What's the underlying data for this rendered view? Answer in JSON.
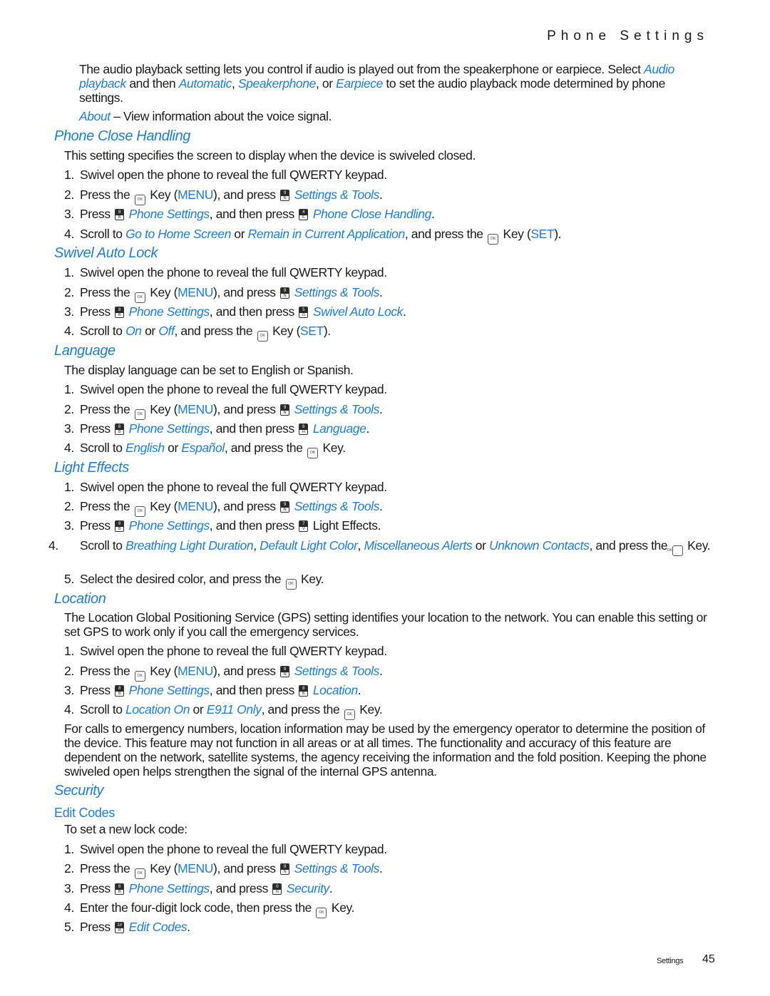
{
  "header": {
    "running_title": "Phone Settings"
  },
  "icons": {
    "ok_key": {
      "name": "ok-key-icon",
      "label": "OK"
    },
    "key_9N": {
      "top": "9",
      "bottom": "N"
    },
    "key_8B": {
      "top": "8",
      "bottom": "B"
    },
    "key_4F": {
      "top": "4",
      "bottom": "F"
    },
    "key_5G": {
      "top": "5",
      "bottom": "G"
    },
    "key_6H": {
      "top": "6",
      "bottom": "H"
    },
    "key_7V": {
      "top": "7",
      "bottom": "V"
    },
    "key_8B2": {
      "top": "8",
      "bottom": "B"
    },
    "key_0N": {
      "top": "0",
      "bottom": "N"
    },
    "key_1R": {
      "top": "1#",
      "bottom": "R"
    }
  },
  "colors": {
    "accent": "#1a7ee0",
    "text": "#1a1a1a"
  },
  "intro": {
    "p1_a": "The audio playback setting lets you control if audio is played out from the speakerphone or earpiece. Select ",
    "p1_link1": "Audio playback",
    "p1_b": " and then ",
    "p1_link2": "Automatic",
    "p1_c": ", ",
    "p1_link3": "Speakerphone",
    "p1_d": ", or ",
    "p1_link4": "Earpiece",
    "p1_e": " to set the audio playback mode determined by phone settings.",
    "about_link": "About",
    "about_text": " – View information about the voice signal."
  },
  "common": {
    "step1": "Swivel open the phone to reveal the full QWERTY keypad.",
    "press_the": "Press the ",
    "key_menu_a": " Key (",
    "menu": "MENU",
    "key_menu_b": "), and press ",
    "settings_tools": "Settings & Tools",
    "period": ".",
    "press": "Press ",
    "phone_settings": "Phone Settings",
    "and_then_press": ", and then press ",
    "and_press": ", and press ",
    "scroll_to": "Scroll to ",
    "or": " or ",
    "and_press_the": ", and press the ",
    "key_set_a": " Key (",
    "set": "SET",
    "key_set_b": ").",
    "key_end": " Key."
  },
  "sections": {
    "phone_close": {
      "title": "Phone Close Handling",
      "desc": "This setting specifies the screen to display when the device is swiveled closed.",
      "target": "Phone Close Handling",
      "opt1": "Go to Home Screen",
      "opt2": "Remain in Current Application"
    },
    "swivel_lock": {
      "title": "Swivel Auto Lock",
      "target": "Swivel Auto Lock",
      "opt1": "On",
      "opt2": "Off"
    },
    "language": {
      "title": "Language",
      "desc": "The display language can be set to English or Spanish.",
      "target": "Language",
      "opt1": "English",
      "opt2": "Español"
    },
    "light_effects": {
      "title": "Light Effects",
      "target_plain": " Light Effects.",
      "opt1": "Breathing Light Duration",
      "opt2": "Default Light Color",
      "opt3": "Miscellaneous Alerts",
      "opt4": "Unknown Contacts",
      "step4_sep": ", ",
      "step4_end": ", and press the ",
      "step4_key": "Key.",
      "step5": "Select the desired color, and press the "
    },
    "location": {
      "title": "Location",
      "desc": "The Location Global Positioning Service (GPS) setting identifies your location to the network. You can enable this setting or set GPS to work only if you call the emergency services.",
      "target": "Location",
      "opt1": "Location On",
      "opt2": "E911 Only",
      "note": "For calls to emergency numbers, location information may be used by the emergency operator to determine the position of the device. This feature may not function in all areas or at all times. The functionality and accuracy of this feature are dependent on the network, satellite systems, the agency receiving the information and the fold position. Keeping the phone swiveled open helps strengthen the signal of the internal GPS antenna."
    },
    "security": {
      "title": "Security",
      "subtitle": "Edit Codes",
      "desc": "To set a new lock code:",
      "target": "Security",
      "step4": "Enter the four-digit lock code, then press the ",
      "step5_target": "Edit Codes"
    }
  },
  "footer": {
    "section_label": "Settings",
    "page_number": "45"
  }
}
